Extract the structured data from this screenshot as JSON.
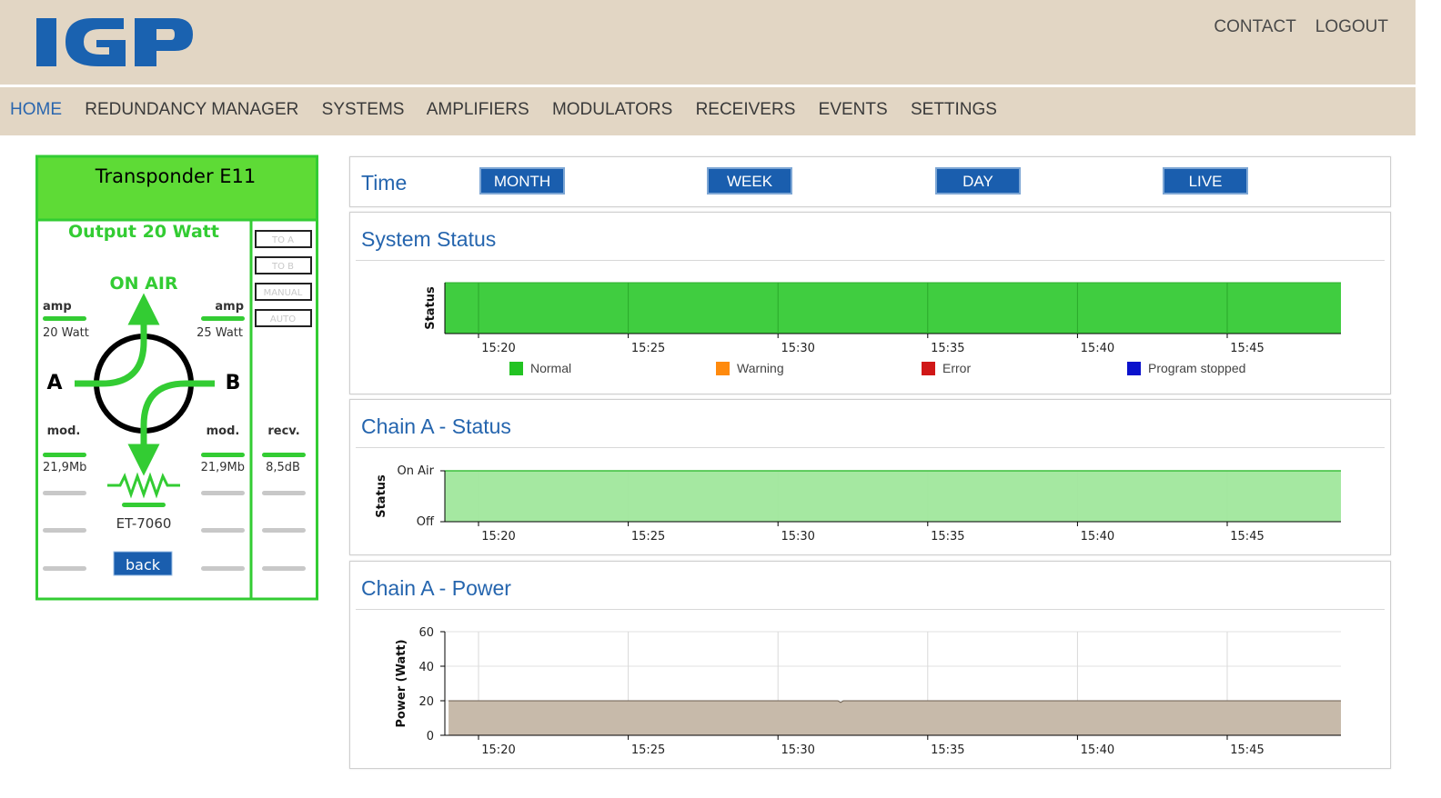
{
  "header": {
    "logo_text": "IGP",
    "logo_color": "#1a62b0",
    "links": [
      "CONTACT",
      "LOGOUT"
    ]
  },
  "nav": {
    "items": [
      "HOME",
      "REDUNDANCY MANAGER",
      "SYSTEMS",
      "AMPLIFIERS",
      "MODULATORS",
      "RECEIVERS",
      "EVENTS",
      "SETTINGS"
    ],
    "active": "HOME"
  },
  "transponder": {
    "title": "Transponder E11",
    "output": "Output 20 Watt",
    "state": "ON AIR",
    "amp_label": "amp",
    "amp_a": "20 Watt",
    "amp_b": "25 Watt",
    "chain_a": "A",
    "chain_b": "B",
    "mod_label": "mod.",
    "mod_a": "21,9Mb",
    "mod_b": "21,9Mb",
    "recv_label": "recv.",
    "recv_value": "8,5dB",
    "load": "ET-7060",
    "back": "back",
    "controls": [
      "TO A",
      "TO B",
      "MANUAL",
      "AUTO"
    ],
    "accent": "#5edb36"
  },
  "time": {
    "label": "Time",
    "buttons": [
      "MONTH",
      "WEEK",
      "DAY",
      "LIVE"
    ]
  },
  "system_status": {
    "title": "System Status",
    "legend": [
      {
        "label": "Normal",
        "color": "#22c322"
      },
      {
        "label": "Warning",
        "color": "#ff8a0d"
      },
      {
        "label": "Error",
        "color": "#d01717"
      },
      {
        "label": "Program stopped",
        "color": "#0a12cc"
      }
    ]
  },
  "chain_a_status": {
    "title": "Chain A - Status"
  },
  "chain_a_power": {
    "title": "Chain A - Power"
  },
  "chart_data": [
    {
      "type": "area",
      "title": "System Status",
      "ylabel": "Status",
      "x_ticks": [
        "15:20",
        "15:25",
        "15:30",
        "15:35",
        "15:40",
        "15:45"
      ],
      "series": [
        {
          "name": "Normal",
          "values": [
            1,
            1,
            1,
            1,
            1,
            1
          ]
        }
      ],
      "fill_color": "#40cd40",
      "grid": true
    },
    {
      "type": "area",
      "title": "Chain A - Status",
      "ylabel": "Status",
      "y_ticks": [
        "Off",
        "On Air"
      ],
      "x_ticks": [
        "15:20",
        "15:25",
        "15:30",
        "15:35",
        "15:40",
        "15:45"
      ],
      "values": [
        "On Air",
        "On Air",
        "On Air",
        "On Air",
        "On Air",
        "On Air"
      ],
      "fill_color": "#a0e79c",
      "grid": true
    },
    {
      "type": "area",
      "title": "Chain A - Power",
      "ylabel": "Power (Watt)",
      "ylim": [
        0,
        60
      ],
      "y_ticks": [
        "0",
        "20",
        "40",
        "60"
      ],
      "x_ticks": [
        "15:20",
        "15:25",
        "15:30",
        "15:35",
        "15:40",
        "15:45"
      ],
      "x": [
        "15:19",
        "15:32",
        "15:32",
        "15:32",
        "15:49"
      ],
      "values": [
        20,
        20,
        19,
        20,
        20
      ],
      "fill_color": "#c7baaa",
      "grid": true
    }
  ]
}
